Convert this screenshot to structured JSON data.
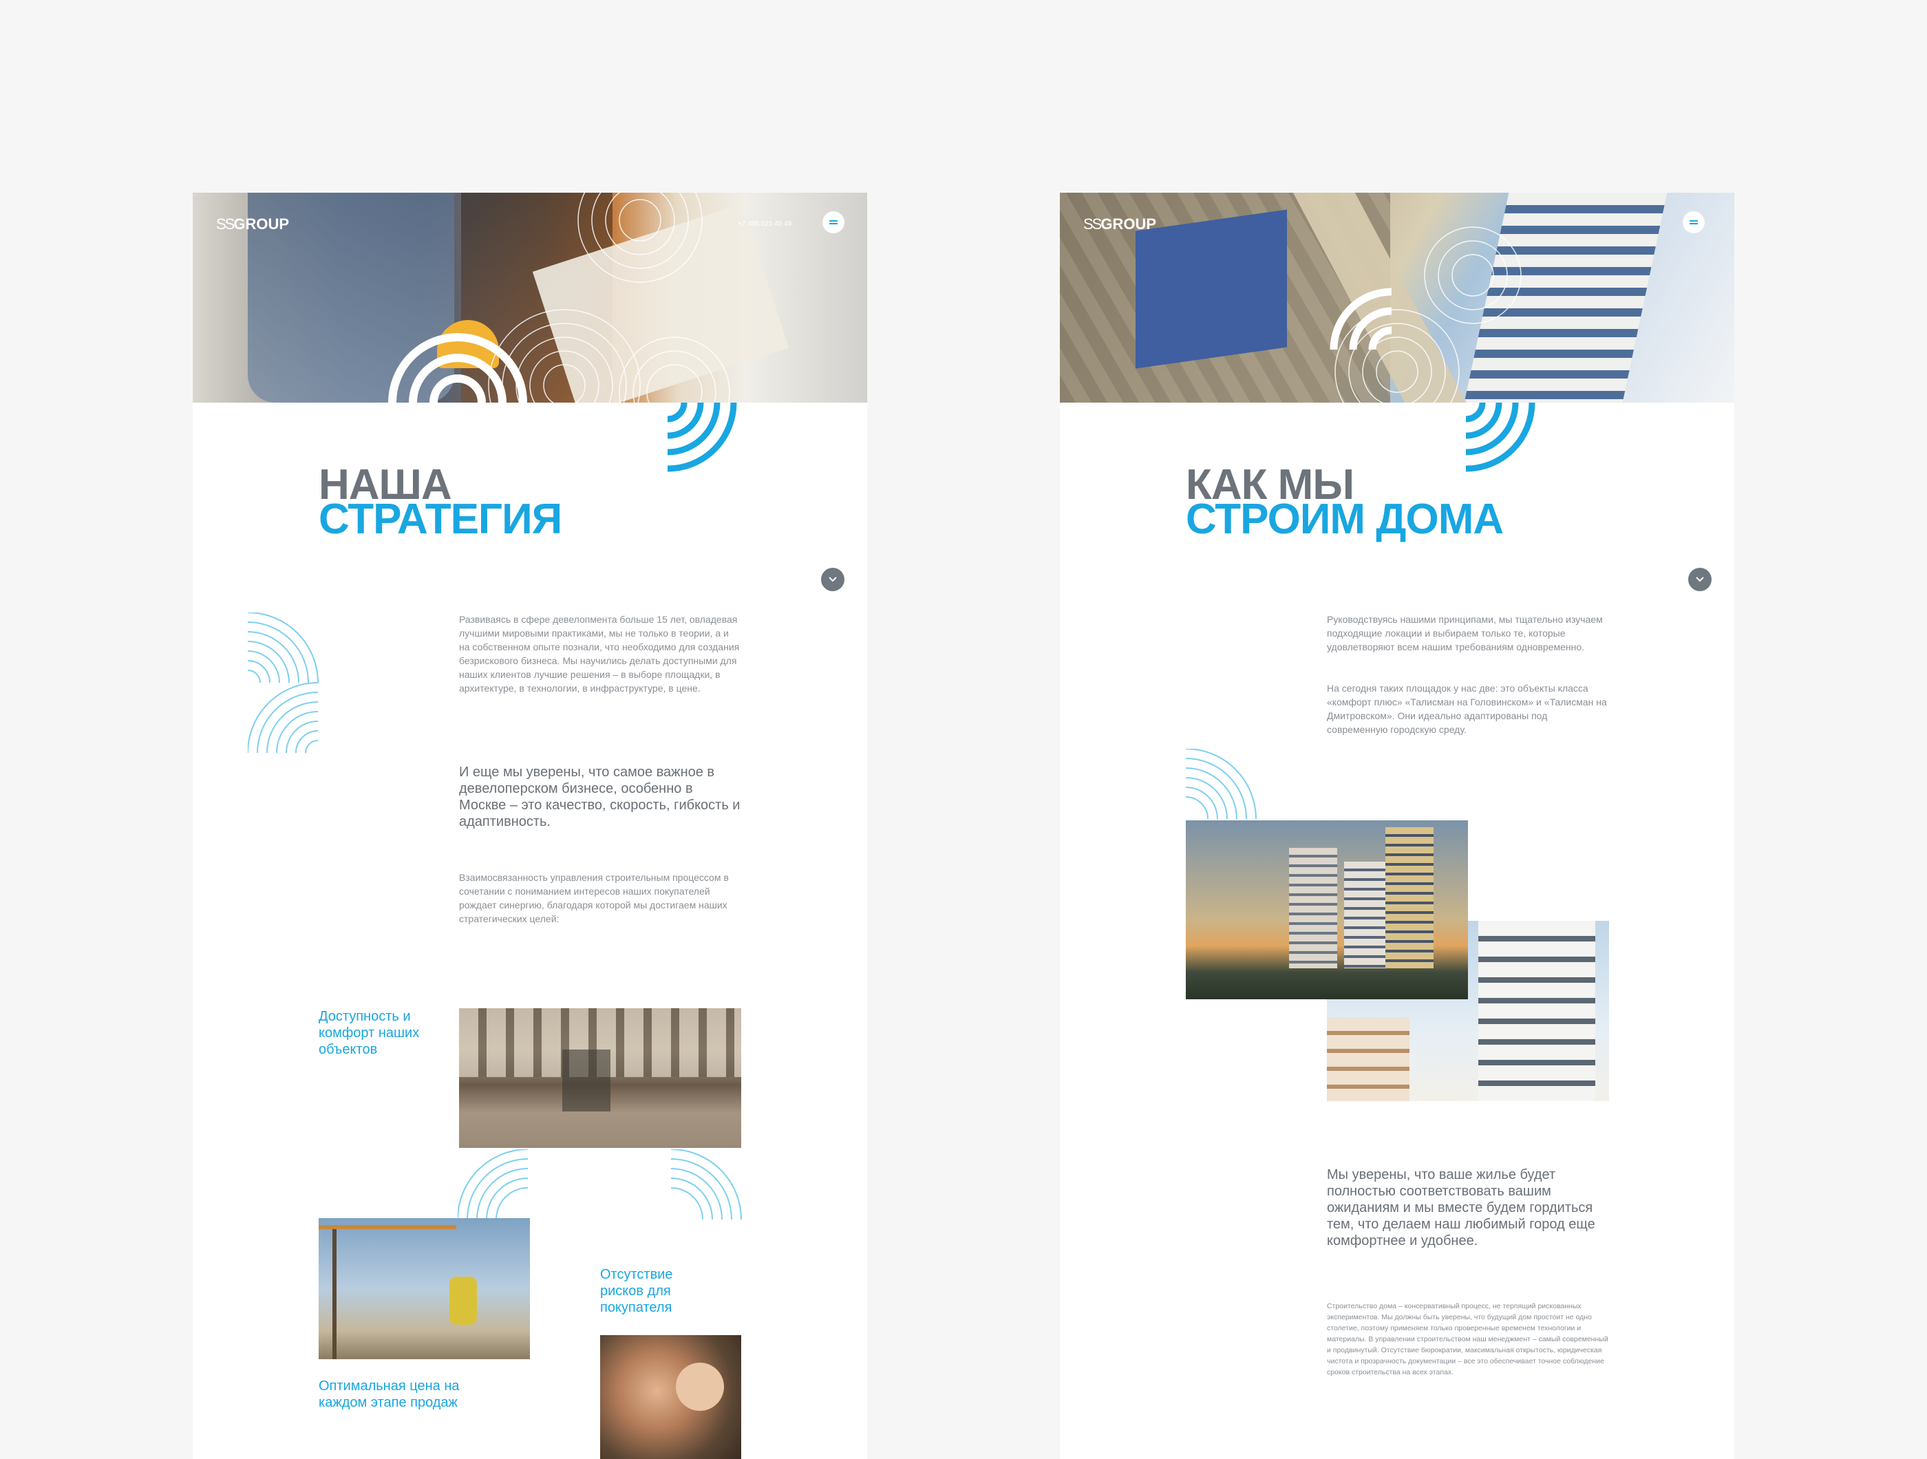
{
  "left": {
    "logo": "GROUP",
    "phone": "+7 495 021 40 49",
    "title_line1": "Наша",
    "title_line2": "Стратегия",
    "para1": "Развиваясь в сфере девелопмента больше 15 лет, овладевая лучшими мировыми практиками, мы не только в теории, а и на собственном опыте познали, что необходимо для создания безрискового бизнеса. Мы научились делать доступными для наших клиентов лучшие решения – в выборе площадки, в архитектуре, в технологии, в инфраструктуре, в цене.",
    "para2": "И еще мы уверены, что самое важное в девелоперском бизнесе, особенно в Москве – это качество, скорость, гибкость и адаптивность.",
    "para3": "Взаимосвязанность управления строительным процессом в сочетании с пониманием интересов наших покупателей рождает синергию, благодаря которой мы достигаем наших стратегических целей:",
    "caption1": "Доступность и комфорт наших объектов",
    "caption2": "Отсутствие рисков для покупателя",
    "caption3": "Оптимальная цена на каждом этапе продаж"
  },
  "right": {
    "logo": "GROUP",
    "title_line1": "Как мы",
    "title_line2": "строим дома",
    "para1": "Руководствуясь нашими принципами, мы тщательно изучаем подходящие локации и выбираем только те, которые удовлетворяют всем нашим требованиям одновременно.",
    "para2": "На сегодня таких площадок у нас две: это объекты класса «комфорт плюс» «Талисман на Головинском» и «Талисман на Дмитровском». Они идеально адаптированы под современную городскую среду.",
    "para3": "Мы уверены, что ваше жилье будет полностью соответствовать вашим ожиданиям и мы вместе будем гордиться тем, что делаем наш любимый город еще комфортнее и удобнее.",
    "para4": "Строительство дома – консервативный процесс, не терпящий рискованных экспериментов. Мы должны быть уверены, что будущий дом простоит не одно столетие, поэтому применяем только проверенные временем технологии и материалы. В управлении строительством наш менеджмент – самый современный и продвинутый. Отсутствие бюрократии, максимальная открытость, юридическая чистота и прозрачность документации – все это обеспечивает точное соблюдение сроков строительства на всех этапах."
  },
  "colors": {
    "accent": "#19a6e1",
    "gray_title": "#6c737a",
    "text": "#8a8f95"
  },
  "icons": [
    "menu-icon",
    "chevron-down-icon",
    "arc-pattern-icon"
  ]
}
